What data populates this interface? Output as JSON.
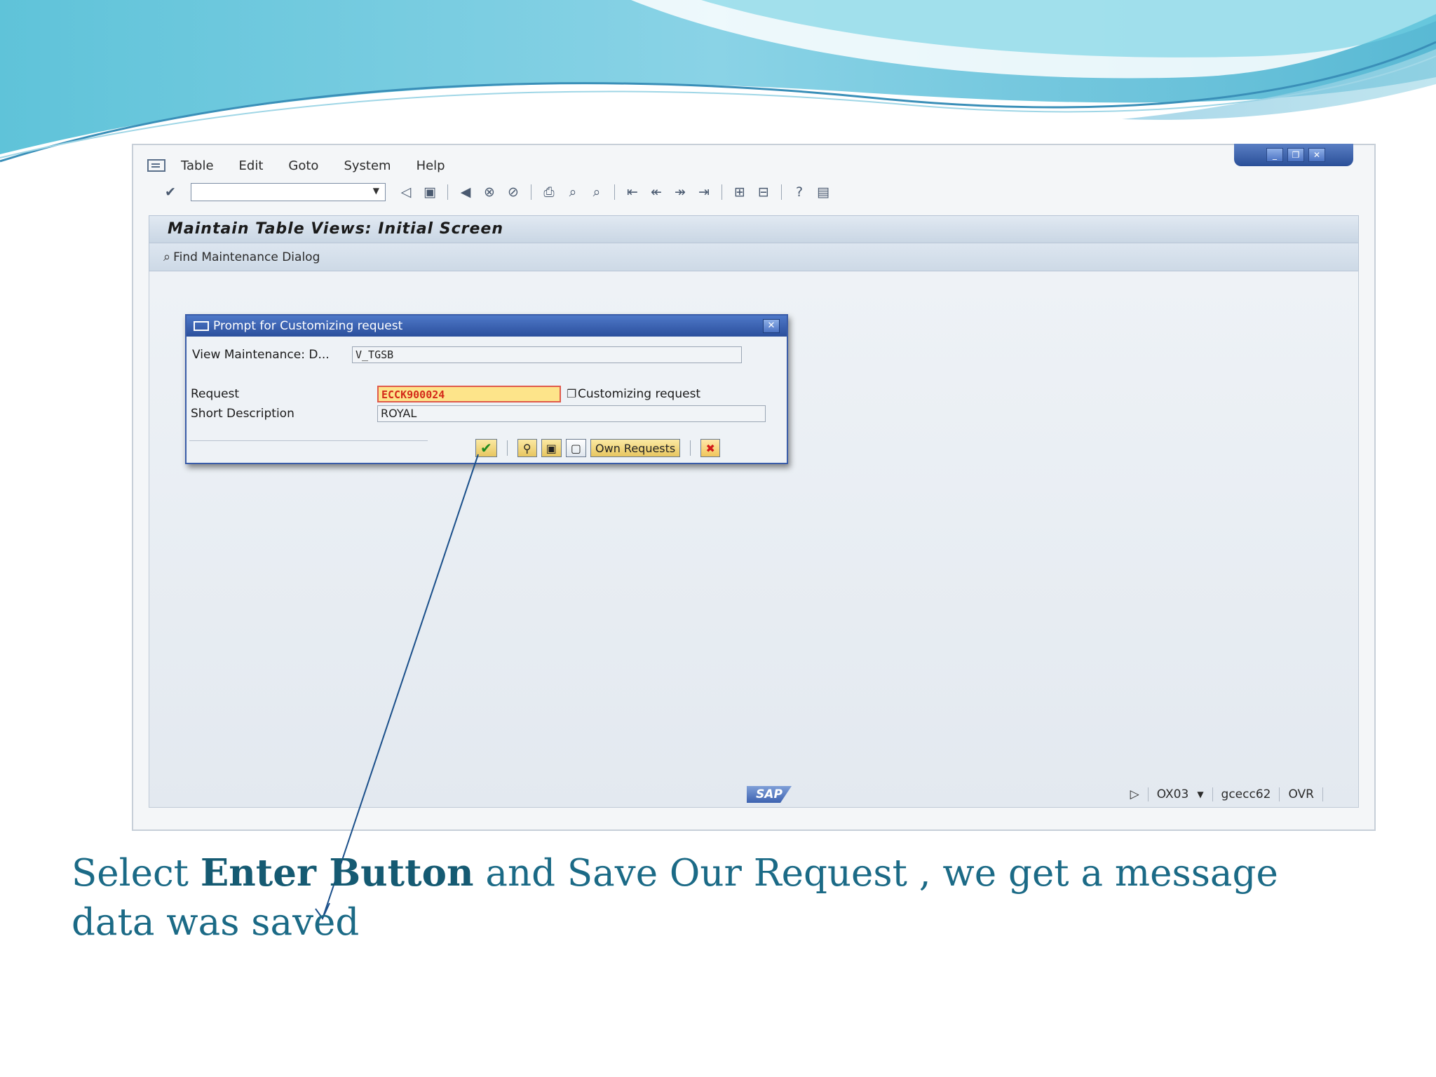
{
  "menubar": {
    "items": [
      "Table",
      "Edit",
      "Goto",
      "System",
      "Help"
    ]
  },
  "window_controls": [
    "minimize",
    "restore",
    "close"
  ],
  "screen": {
    "title": "Maintain Table Views: Initial Screen",
    "app_toolbar_label": "Find Maintenance Dialog"
  },
  "dialog": {
    "title": "Prompt for Customizing request",
    "view_label": "View Maintenance: D...",
    "view_value": "V_TGSB",
    "request_label": "Request",
    "request_value": "ECCK900024",
    "request_type": "Customizing request",
    "short_desc_label": "Short Description",
    "short_desc_value": "ROYAL",
    "own_requests_label": "Own Requests"
  },
  "statusbar": {
    "logo": "SAP",
    "transaction": "OX03",
    "system": "gcecc62",
    "mode": "OVR"
  },
  "caption": {
    "part1": "Select ",
    "bold": "Enter Button",
    "part2": " and Save Our Request , we get a message data was saved"
  },
  "colors": {
    "accent_blue": "#2b4f9c",
    "caption": "#1b6a86",
    "request_highlight": "#fde48a",
    "request_text": "#d42a1a"
  }
}
